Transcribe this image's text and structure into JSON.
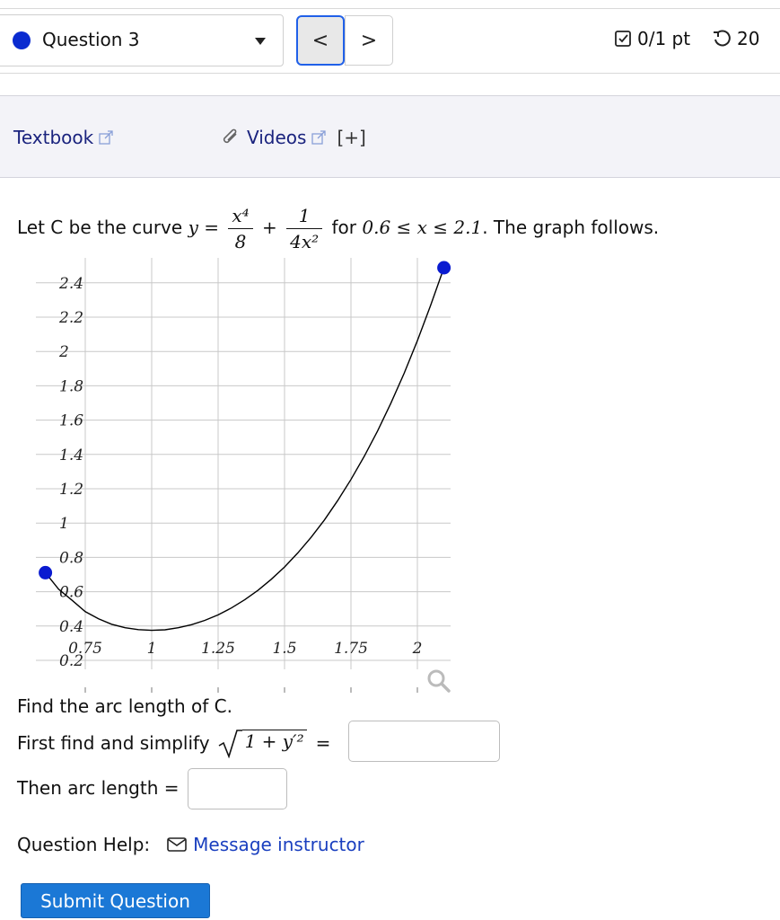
{
  "header": {
    "question_label": "Question 3",
    "prev_label": "<",
    "next_label": ">",
    "score": "0/1 pt",
    "attempts": "20"
  },
  "resources": {
    "textbook_label": "Textbook",
    "videos_label": "Videos",
    "expand_label": "[+]"
  },
  "prompt": {
    "lead": "Let C be the curve",
    "eq_y": "y =",
    "frac1_num": "x⁴",
    "frac1_den": "8",
    "plus": "+",
    "frac2_num": "1",
    "frac2_den": "4x²",
    "for_text": "for",
    "domain": "0.6 ≤ x ≤ 2.1",
    "tail": ". The graph follows."
  },
  "chart_data": {
    "type": "line",
    "function": "y = x^4/8 + 1/(4x^2)",
    "x_domain": [
      0.6,
      2.1
    ],
    "series": [
      {
        "x": [
          0.6,
          0.65,
          0.7,
          0.75,
          0.8,
          0.85,
          0.9,
          0.95,
          1.0,
          1.05,
          1.1,
          1.15,
          1.2,
          1.25,
          1.3,
          1.35,
          1.4,
          1.45,
          1.5,
          1.55,
          1.6,
          1.65,
          1.7,
          1.75,
          1.8,
          1.85,
          1.9,
          1.95,
          2.0,
          2.05,
          2.1
        ],
        "y": [
          0.711,
          0.614,
          0.55,
          0.484,
          0.442,
          0.41,
          0.39,
          0.379,
          0.375,
          0.378,
          0.39,
          0.408,
          0.433,
          0.465,
          0.505,
          0.553,
          0.608,
          0.672,
          0.744,
          0.826,
          0.917,
          1.018,
          1.131,
          1.254,
          1.389,
          1.536,
          1.698,
          1.872,
          2.063,
          2.269,
          2.488
        ]
      }
    ],
    "endpoints": [
      {
        "x": 0.6,
        "y": 0.711
      },
      {
        "x": 2.1,
        "y": 2.488
      }
    ],
    "x_ticks": [
      "0.75",
      "1",
      "1.25",
      "1.5",
      "1.75",
      "2"
    ],
    "y_ticks": [
      "0.2",
      "0.4",
      "0.6",
      "0.8",
      "1",
      "1.2",
      "1.4",
      "1.6",
      "1.8",
      "2",
      "2.2",
      "2.4"
    ],
    "xlim": [
      0.6,
      2.1
    ],
    "ylim": [
      0.2,
      2.5
    ],
    "grid": true,
    "colors": {
      "curve": "#000000",
      "endpoint": "#0a1bd0",
      "grid": "#c8c8c8"
    }
  },
  "questions": {
    "find_text": "Find the arc length of C.",
    "first_text": "First find and simplify",
    "sqrt_expr": "1 + y′²",
    "equals": "=",
    "then_text": "Then arc length =",
    "answer1_value": "",
    "answer2_value": ""
  },
  "help": {
    "label": "Question Help:",
    "message_label": "Message instructor"
  },
  "submit_label": "Submit Question",
  "colors": {
    "accent": "#1b78d6",
    "link": "#1a237e",
    "question_dot": "#0a2bd0"
  }
}
